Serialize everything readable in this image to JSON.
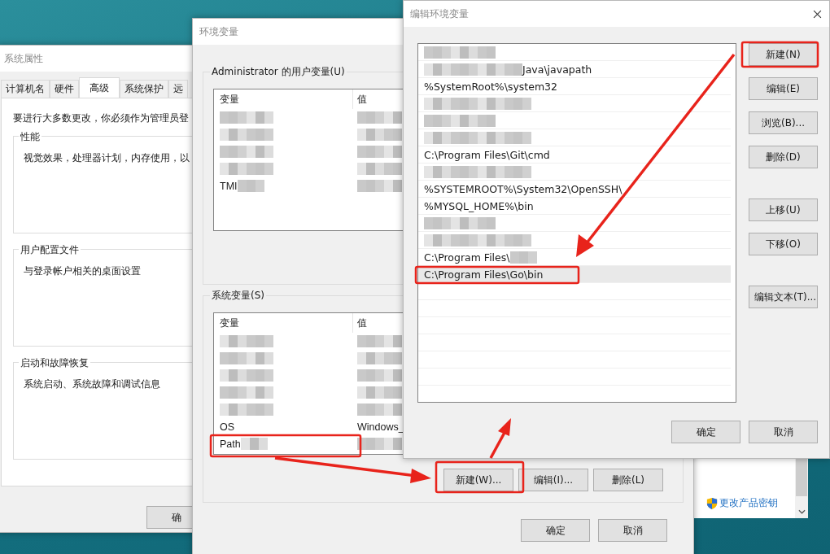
{
  "system_properties": {
    "title": "系统属性",
    "tabs": [
      {
        "label": "计算机名",
        "selected": false
      },
      {
        "label": "硬件",
        "selected": false
      },
      {
        "label": "高级",
        "selected": true
      },
      {
        "label": "系统保护",
        "selected": false
      },
      {
        "label": "远",
        "selected": false
      }
    ],
    "notice": "要进行大多数更改，你必须作为管理员登",
    "groups": [
      {
        "title": "性能",
        "text": "视觉效果，处理器计划，内存使用，以"
      },
      {
        "title": "用户配置文件",
        "text": "与登录帐户相关的桌面设置"
      },
      {
        "title": "启动和故障恢复",
        "text": "系统启动、系统故障和调试信息"
      }
    ],
    "buttons": [
      "确"
    ]
  },
  "background_window": {
    "link": "更改产品密钥"
  },
  "environment_variables": {
    "title": "环境变量",
    "user_group": {
      "title": "Administrator 的用户变量(U)",
      "columns": [
        "变量",
        "值"
      ],
      "rows": [
        {
          "kind": "redacted"
        },
        {
          "kind": "redacted"
        },
        {
          "kind": "redacted"
        },
        {
          "kind": "redacted"
        },
        {
          "kind": "redacted",
          "name": "TMI"
        }
      ]
    },
    "system_group": {
      "title": "系统变量(S)",
      "columns": [
        "变量",
        "值"
      ],
      "rows": [
        {
          "kind": "redacted"
        },
        {
          "kind": "redacted"
        },
        {
          "kind": "redacted"
        },
        {
          "kind": "redacted"
        },
        {
          "kind": "redacted"
        },
        {
          "kind": "plain",
          "name": "OS",
          "value": "Windows_"
        },
        {
          "kind": "redacted",
          "name": "Path"
        }
      ]
    },
    "list_buttons": [
      "新建(W)...",
      "编辑(I)...",
      "删除(L)"
    ],
    "buttons": [
      "确定",
      "取消"
    ]
  },
  "edit_dialog": {
    "title": "编辑环境变量",
    "entries": [
      {
        "kind": "redacted",
        "selected": false
      },
      {
        "kind": "prefixed",
        "text": "Java\\javapath",
        "selected": false
      },
      {
        "kind": "plain",
        "text": "%SystemRoot%\\system32",
        "selected": false
      },
      {
        "kind": "redacted",
        "selected": false
      },
      {
        "kind": "redacted",
        "selected": false
      },
      {
        "kind": "redacted",
        "selected": false
      },
      {
        "kind": "plain",
        "text": "C:\\Program Files\\Git\\cmd",
        "selected": false
      },
      {
        "kind": "redacted",
        "selected": false
      },
      {
        "kind": "plain",
        "text": "%SYSTEMROOT%\\System32\\OpenSSH\\",
        "selected": false
      },
      {
        "kind": "plain",
        "text": "%MYSQL_HOME%\\bin",
        "selected": false
      },
      {
        "kind": "redacted",
        "selected": false
      },
      {
        "kind": "redacted",
        "selected": false
      },
      {
        "kind": "suffixed",
        "text": "C:\\Program Files\\",
        "selected": false
      },
      {
        "kind": "plain",
        "text": "C:\\Program Files\\Go\\bin",
        "selected": true
      }
    ],
    "side_buttons": [
      "新建(N)",
      "编辑(E)",
      "浏览(B)...",
      "删除(D)",
      "上移(U)",
      "下移(O)",
      "编辑文本(T)..."
    ],
    "buttons": [
      "确定",
      "取消"
    ]
  }
}
